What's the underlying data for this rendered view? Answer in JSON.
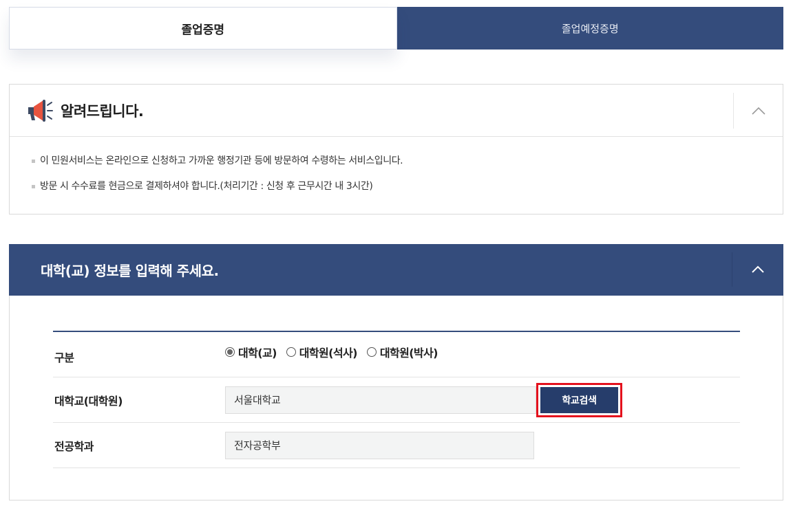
{
  "tabs": {
    "graduation_certificate": "졸업증명",
    "expected_graduation_certificate": "졸업예정증명"
  },
  "notice": {
    "title": "알려드립니다.",
    "items": [
      "이 민원서비스는 온라인으로 신청하고 가까운 행정기관 등에 방문하여 수령하는 서비스입니다.",
      "방문 시 수수료를 현금으로 결제하셔야 합니다.(처리기간 : 신청 후 근무시간 내 3시간)"
    ]
  },
  "info_section": {
    "title": "대학(교) 정보를 입력해 주세요.",
    "rows": {
      "category": {
        "label": "구분",
        "options": [
          "대학(교)",
          "대학원(석사)",
          "대학원(박사)"
        ],
        "selected": "대학(교)"
      },
      "university": {
        "label": "대학교(대학원)",
        "value": "서울대학교",
        "button": "학교검색"
      },
      "major": {
        "label": "전공학과",
        "value": "전자공학부"
      }
    }
  },
  "colors": {
    "primary_navy": "#344c7c",
    "button_navy": "#263d6b",
    "highlight_red": "#e4111d"
  },
  "icons": {
    "notice": "megaphone-icon",
    "collapse": "chevron-up-icon"
  }
}
